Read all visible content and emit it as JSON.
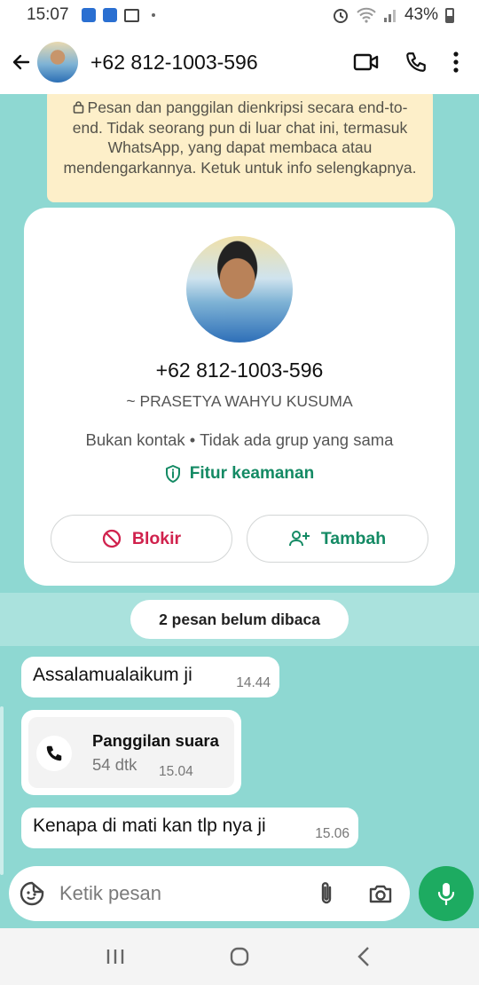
{
  "status_bar": {
    "time": "15:07",
    "battery": "43%",
    "icons": [
      "shield-icon",
      "shield-icon",
      "gallery-icon",
      "alarm-icon",
      "wifi-icon",
      "signal-icon",
      "battery-icon"
    ]
  },
  "header": {
    "title": "+62 812-1003-596",
    "icons": [
      "back-arrow-icon",
      "video-call-icon",
      "voice-call-icon",
      "more-vertical-icon"
    ]
  },
  "encryption_notice": {
    "text": "Pesan dan panggilan dienkripsi secara end-to-end. Tidak seorang pun di luar chat ini, termasuk WhatsApp, yang dapat membaca atau mendengarkannya. Ketuk untuk info selengkapnya."
  },
  "profile_card": {
    "phone": "+62 812-1003-596",
    "name": "~ PRASETYA WAHYU KUSUMA",
    "info": "Bukan kontak • Tidak ada grup yang sama",
    "security_label": "Fitur keamanan",
    "block_label": "Blokir",
    "add_label": "Tambah"
  },
  "unread_label": "2 pesan belum dibaca",
  "messages": [
    {
      "text": "Assalamualaikum ji",
      "time": "14.44"
    },
    {
      "call_title": "Panggilan suara",
      "call_duration": "54 dtk",
      "time": "15.04"
    },
    {
      "text": "Kenapa di mati kan tlp nya ji",
      "time": "15.06"
    }
  ],
  "composer": {
    "placeholder": "Ketik pesan"
  },
  "colors": {
    "chat_bg": "#8ed8d2",
    "accent_green": "#148a64",
    "block_red": "#d0224d",
    "mic_green": "#1dab61",
    "encryption_bg": "#fdefc9"
  }
}
